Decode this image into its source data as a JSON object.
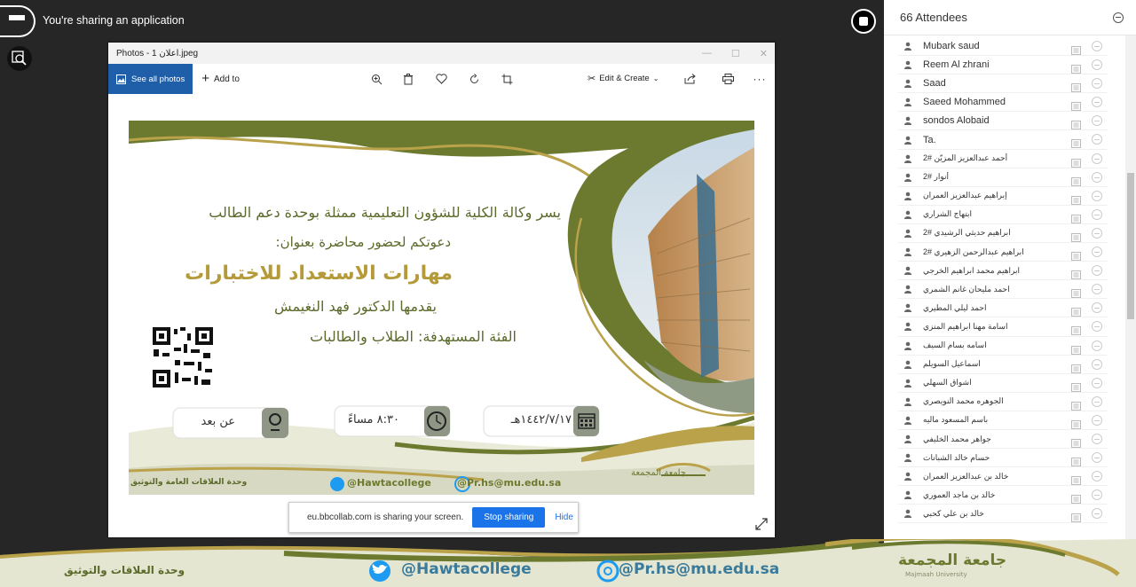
{
  "session": {
    "sharing_label": "You're sharing an application"
  },
  "window": {
    "title": "Photos - اعلان 1.jpeg",
    "see_all_label": "See all photos",
    "add_to_label": "Add to",
    "edit_create_label": "Edit & Create"
  },
  "flyer": {
    "line1": "يسر وكالة الكلية للشؤون التعليمية ممثلة بوحدة دعم الطالب",
    "line2": "دعوتكم لحضور محاضرة بعنوان:",
    "lecture_title": "مهارات الاستعداد للاختبارات",
    "presenter": "يقدمها  الدكتور فهد النغيمش",
    "audience": "الفئة المستهدفة: الطلاب والطالبات",
    "location": "عن بعد",
    "time": "٨:٣٠ مساءً",
    "date": "١٤٤٢/٧/١٧هـ",
    "footer_unit": "وحدة العلاقات العامة والتوثيق",
    "twitter": "@Hawtacollege",
    "email": "@Pr.hs@mu.edu.sa",
    "university": "جامعة المجمعة"
  },
  "share_bar": {
    "message": "eu.bbcollab.com is sharing your screen.",
    "stop_label": "Stop sharing",
    "hide_label": "Hide"
  },
  "attendees": {
    "header": "66 Attendees",
    "items": [
      {
        "name": "Mubark saud"
      },
      {
        "name": "Reem Al zhrani"
      },
      {
        "name": "Saad"
      },
      {
        "name": "Saeed Mohammed"
      },
      {
        "name": "sondos Alobaid"
      },
      {
        "name": "Ta."
      },
      {
        "name": "أحمد عبدالعزيز المزيّن #2"
      },
      {
        "name": "أنوار #2"
      },
      {
        "name": "إبراهيم عبدالعزيز العمران"
      },
      {
        "name": "ابتهاج الشراري"
      },
      {
        "name": "ابراهيم حديثي الرشيدي #2"
      },
      {
        "name": "ابراهيم عبدالرحمن الزهيري #2"
      },
      {
        "name": "ابراهيم محمد ابراهيم الخرجي"
      },
      {
        "name": "احمد مليحان غانم الشمري"
      },
      {
        "name": "احمد ليلي المطيري"
      },
      {
        "name": "اسامة مهنا ابراهيم المنزي"
      },
      {
        "name": "اسامه بسام السيف"
      },
      {
        "name": "اسماعيل السويلم"
      },
      {
        "name": "اشواق السهلي"
      },
      {
        "name": "الجوهره محمد النويصري"
      },
      {
        "name": "باسم المسعود ماليه"
      },
      {
        "name": "جواهر محمد الخليفي"
      },
      {
        "name": "حسام خالد الشبانات"
      },
      {
        "name": "خالد بن عبدالعزيز العمران"
      },
      {
        "name": "خالد بن ماجد العموري"
      },
      {
        "name": "خالد بن علي كحبي"
      }
    ]
  },
  "banner": {
    "unit": "وحدة العلاقات والتوثيق",
    "twitter": "@Hawtacollege",
    "email": "@Pr.hs@mu.edu.sa",
    "university": "جامعة المجمعة",
    "university_en": "Majmaah University"
  },
  "colors": {
    "olive": "#6b7a2e",
    "gold": "#b9a24a",
    "blue": "#1f5fa9",
    "twitter": "#1d9bf0"
  }
}
